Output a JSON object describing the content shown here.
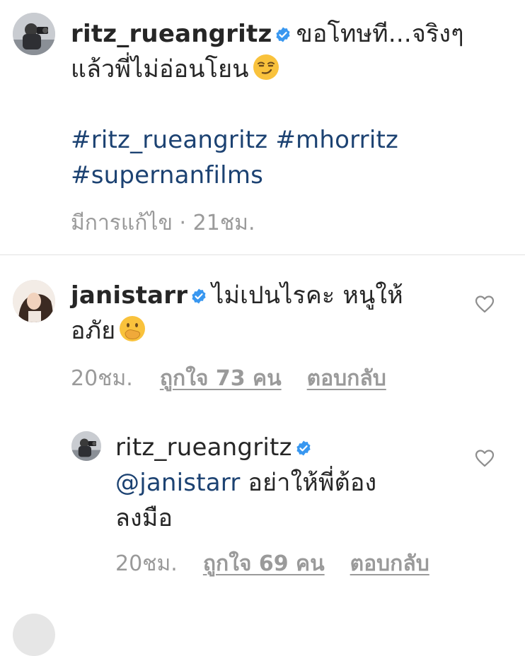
{
  "caption": {
    "username": "ritz_rueangritz",
    "text_line1": "ขอโทษที...จริงๆ",
    "text_line2": "แล้วพี่ไม่อ่อนโยน",
    "emoji_icon": "smirking-face-icon",
    "hashtag1": "#ritz_rueangritz",
    "hashtag2": "#mhorritz",
    "hashtag3": "#supernanfilms",
    "edited_label": "มีการแก้ไข",
    "separator": "·",
    "time": "21ชม."
  },
  "comments": [
    {
      "username": "janistarr",
      "text_line1": "ไม่เปนไรคะ หนูให้",
      "text_line2": "อภัย",
      "emoji_icon": "face-with-hand-over-mouth-icon",
      "time": "20ชม.",
      "likes_label": "ถูกใจ 73 คน",
      "reply_label": "ตอบกลับ"
    },
    {
      "username": "ritz_rueangritz",
      "mention": "@janistarr",
      "text_line1": "อย่าให้พี่ต้อง",
      "text_line2": "ลงมือ",
      "time": "20ชม.",
      "likes_label": "ถูกใจ 69 คน",
      "reply_label": "ตอบกลับ"
    }
  ],
  "colors": {
    "link_blue": "#1c4272",
    "meta_gray": "#9a9a9a",
    "verified_blue": "#3897f0",
    "text": "#262626"
  }
}
